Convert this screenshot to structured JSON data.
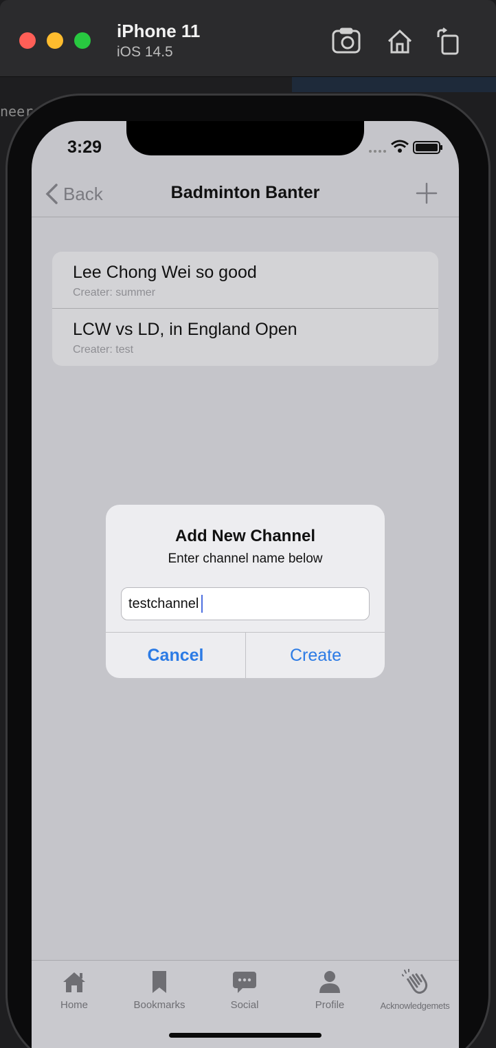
{
  "simulator": {
    "device_name": "iPhone 11",
    "os_version": "iOS 14.5",
    "toolbar_icons": [
      "screenshot-icon",
      "home-icon",
      "rotate-icon"
    ]
  },
  "background_fragments": [
    "neer"
  ],
  "status_bar": {
    "time": "3:29",
    "icons": [
      "signal-icon",
      "wifi-icon",
      "battery-icon"
    ]
  },
  "nav": {
    "back_label": "Back",
    "title": "Badminton Banter",
    "add_icon": "plus-icon"
  },
  "channels": [
    {
      "title": "Lee Chong Wei so good",
      "creator": "Creater: summer"
    },
    {
      "title": "LCW vs LD, in England Open",
      "creator": "Creater: test"
    }
  ],
  "alert": {
    "title": "Add New Channel",
    "message": "Enter channel name below",
    "input_value": "testchannel",
    "cancel_label": "Cancel",
    "create_label": "Create",
    "button_color": "#2c7be5"
  },
  "tabbar": {
    "items": [
      {
        "label": "Home",
        "icon": "house-icon"
      },
      {
        "label": "Bookmarks",
        "icon": "bookmark-icon"
      },
      {
        "label": "Social",
        "icon": "chat-bubble-icon"
      },
      {
        "label": "Profile",
        "icon": "person-icon"
      },
      {
        "label": "Acknowledgemets",
        "icon": "clapping-hands-icon"
      }
    ]
  }
}
